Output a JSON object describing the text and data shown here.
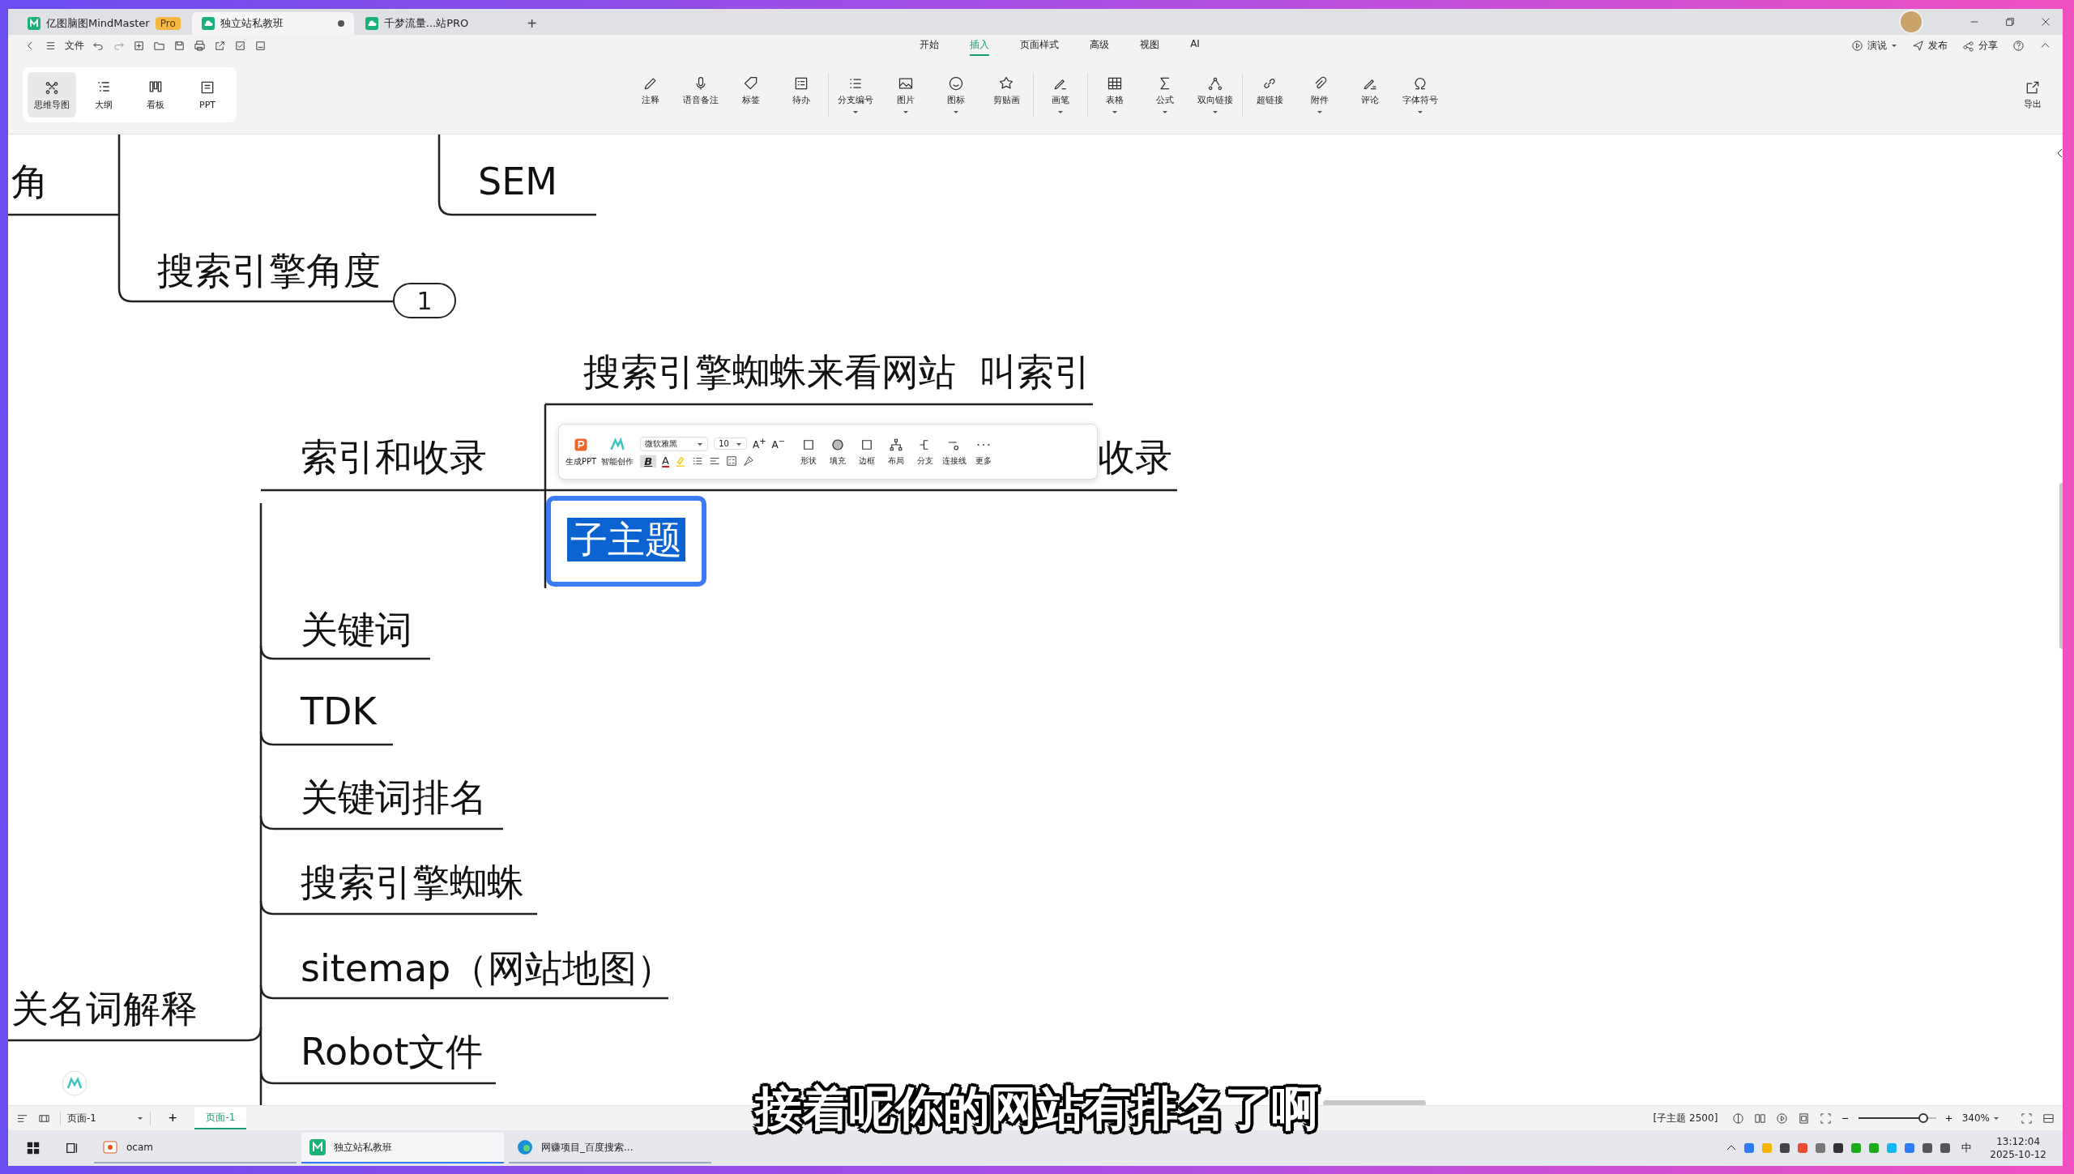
{
  "tabs": [
    {
      "label": "亿图脑图MindMaster",
      "badge": "Pro",
      "selected": false,
      "modified": false
    },
    {
      "label": "独立站私教班",
      "selected": true,
      "modified": true
    },
    {
      "label": "千梦流量...站PRO",
      "selected": false,
      "modified": false
    }
  ],
  "new_tab": "+",
  "menu": {
    "file": "文件",
    "tabs": [
      {
        "label": "开始",
        "selected": false
      },
      {
        "label": "插入",
        "selected": true
      },
      {
        "label": "页面样式",
        "selected": false
      },
      {
        "label": "高级",
        "selected": false
      },
      {
        "label": "视图",
        "selected": false
      },
      {
        "label": "AI",
        "selected": false
      }
    ],
    "actions": [
      {
        "label": "演说",
        "dropdown": true
      },
      {
        "label": "发布",
        "dropdown": false
      },
      {
        "label": "分享",
        "dropdown": false
      }
    ]
  },
  "views": [
    {
      "label": "思维导图",
      "selected": true
    },
    {
      "label": "大纲",
      "selected": false
    },
    {
      "label": "看板",
      "selected": false
    },
    {
      "label": "PPT",
      "selected": false
    }
  ],
  "ribbon": [
    {
      "label": "注释",
      "dropdown": false
    },
    {
      "label": "语音备注",
      "dropdown": false
    },
    {
      "label": "标签",
      "dropdown": false
    },
    {
      "label": "待办",
      "dropdown": false
    },
    {
      "label": "分支编号",
      "dropdown": true
    },
    {
      "label": "图片",
      "dropdown": true
    },
    {
      "label": "图标",
      "dropdown": true
    },
    {
      "label": "剪贴画",
      "dropdown": false
    },
    {
      "label": "画笔",
      "dropdown": true
    },
    {
      "label": "表格",
      "dropdown": true
    },
    {
      "label": "公式",
      "dropdown": true
    },
    {
      "label": "双向链接",
      "dropdown": true
    },
    {
      "label": "超链接",
      "dropdown": false
    },
    {
      "label": "附件",
      "dropdown": true
    },
    {
      "label": "评论",
      "dropdown": false
    },
    {
      "label": "字体符号",
      "dropdown": true
    }
  ],
  "export": "导出",
  "mindmap": {
    "nodes": [
      {
        "text": "角",
        "selected": false
      },
      {
        "text": "SEM",
        "selected": false
      },
      {
        "text": "搜索引擎角度",
        "selected": false,
        "badge": "1"
      },
      {
        "text": "搜索引擎蜘蛛来看网站  叫索引",
        "selected": false
      },
      {
        "text": "索引和收录",
        "selected": false
      },
      {
        "text": "收录",
        "selected": false
      },
      {
        "text": "子主题",
        "selected": true
      },
      {
        "text": "关键词",
        "selected": false
      },
      {
        "text": "TDK",
        "selected": false
      },
      {
        "text": "关键词排名",
        "selected": false
      },
      {
        "text": "搜索引擎蜘蛛",
        "selected": false
      },
      {
        "text": "sitemap（网站地图）",
        "selected": false
      },
      {
        "text": "Robot文件",
        "selected": false
      },
      {
        "text": "关名词解释",
        "selected": false
      }
    ]
  },
  "float_toolbar": {
    "actions": [
      {
        "label": "生成PPT"
      },
      {
        "label": "智能创作"
      }
    ],
    "font": "微软雅黑",
    "size": "10",
    "grow": "A$^{+}$",
    "shrink": "A$^{−}$",
    "bold": {
      "label": "B",
      "on": true
    },
    "font_color": "A",
    "tools": [
      {
        "label": "形状"
      },
      {
        "label": "填充"
      },
      {
        "label": "边框"
      },
      {
        "label": "布局"
      },
      {
        "label": "分支"
      },
      {
        "label": "连接线"
      },
      {
        "label": "更多"
      }
    ]
  },
  "subtitle": "接着呢你的网站有排名了啊",
  "status": {
    "page_select": "页面-1",
    "add": "+",
    "pages": [
      {
        "label": "页面-1",
        "selected": true
      }
    ],
    "info": "[子主题 2500]",
    "zoom_out": "−",
    "zoom_in": "+",
    "zoom": {
      "level": 0.9
    },
    "zoom_text": "340%"
  },
  "taskbar": {
    "items": [
      {
        "label": "ocam",
        "selected": false
      },
      {
        "label": "独立站私教班",
        "selected": true
      },
      {
        "label": "网赚项目_百度搜索...",
        "selected": false
      }
    ],
    "ime": "中",
    "time": "13:12:04",
    "date": "2025-10-12"
  }
}
